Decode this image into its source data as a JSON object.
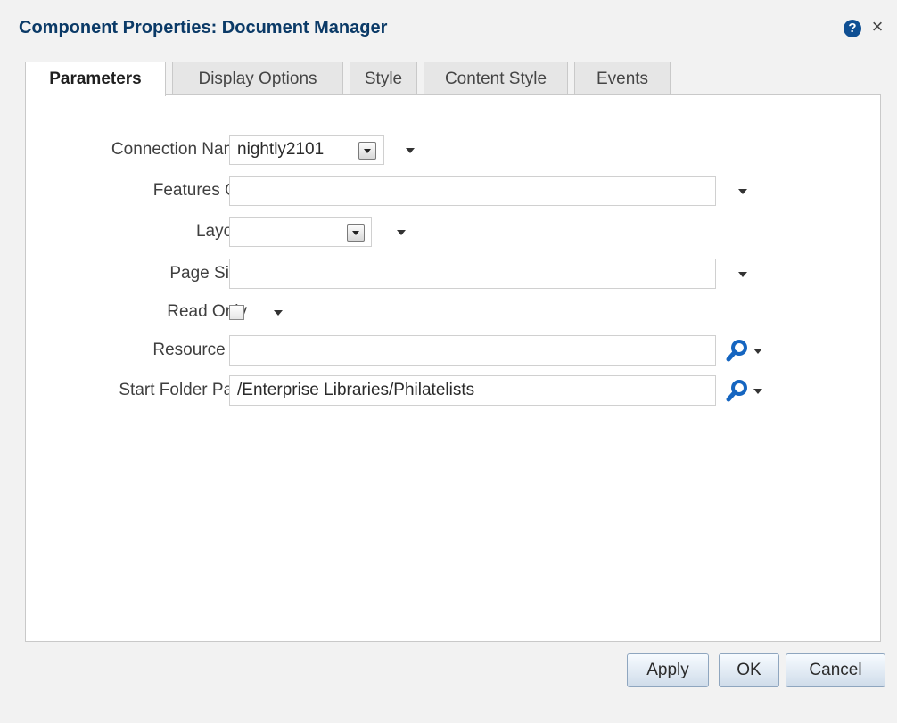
{
  "dialog": {
    "title": "Component Properties: Document Manager"
  },
  "icons": {
    "help": "?",
    "close": "×"
  },
  "tabs": [
    {
      "label": "Parameters",
      "active": true
    },
    {
      "label": "Display Options",
      "active": false
    },
    {
      "label": "Style",
      "active": false
    },
    {
      "label": "Content Style",
      "active": false
    },
    {
      "label": "Events",
      "active": false
    }
  ],
  "fields": {
    "connection_name": {
      "label": "Connection Name",
      "value": "nightly2101"
    },
    "features_off": {
      "label": "Features Off",
      "value": ""
    },
    "layout": {
      "label": "Layout",
      "value": ""
    },
    "page_size": {
      "label": "Page Size",
      "value": ""
    },
    "read_only": {
      "label": "Read Only",
      "checked": false
    },
    "resource_id": {
      "label": "Resource ID",
      "value": ""
    },
    "start_folder_path": {
      "label": "Start Folder Path",
      "value": "/Enterprise Libraries/Philatelists"
    }
  },
  "buttons": {
    "apply": "Apply",
    "ok": "OK",
    "cancel": "Cancel"
  },
  "colors": {
    "title": "#0b3a67",
    "search_icon": "#1565c0",
    "help_icon": "#0f4f93"
  }
}
